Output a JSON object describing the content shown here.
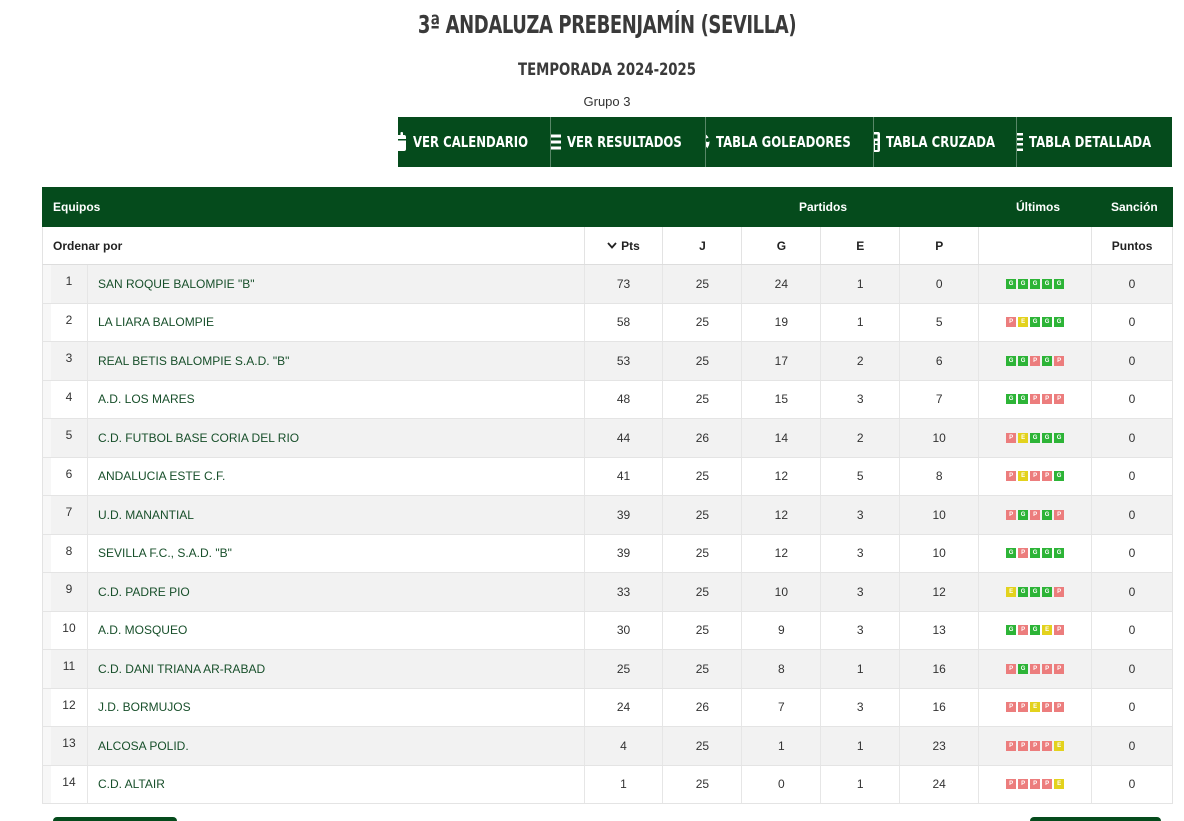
{
  "header": {
    "title": "3ª ANDALUZA PREBENJAMÍN (SEVILLA)",
    "season": "TEMPORADA 2024-2025",
    "group": "Grupo 3"
  },
  "toolbar": [
    {
      "label": "VER CALENDARIO",
      "icon": "calendar-icon"
    },
    {
      "label": "VER RESULTADOS",
      "icon": "list-icon"
    },
    {
      "label": "TABLA GOLEADORES",
      "icon": "soccer-ball-icon"
    },
    {
      "label": "TABLA CRUZADA",
      "icon": "calculator-icon"
    },
    {
      "label": "TABLA DETALLADA",
      "icon": "indent-icon"
    }
  ],
  "table": {
    "header_top": {
      "teams": "Equipos",
      "matches": "Partidos",
      "last": "Últimos",
      "sanction": "Sanción"
    },
    "header_sub": {
      "order_by": "Ordenar por",
      "pts": "Pts",
      "j": "J",
      "g": "G",
      "e": "E",
      "p": "P",
      "points": "Puntos"
    },
    "rows": [
      {
        "pos": "1",
        "team": "SAN ROQUE BALOMPIE \"B\"",
        "pts": "73",
        "j": "25",
        "g": "24",
        "e": "1",
        "p": "0",
        "last": [
          "G",
          "G",
          "G",
          "G",
          "G"
        ],
        "sanction": "0"
      },
      {
        "pos": "2",
        "team": "LA LIARA BALOMPIE",
        "pts": "58",
        "j": "25",
        "g": "19",
        "e": "1",
        "p": "5",
        "last": [
          "P",
          "E",
          "G",
          "G",
          "G"
        ],
        "sanction": "0"
      },
      {
        "pos": "3",
        "team": "REAL BETIS BALOMPIE S.A.D. \"B\"",
        "pts": "53",
        "j": "25",
        "g": "17",
        "e": "2",
        "p": "6",
        "last": [
          "G",
          "G",
          "P",
          "G",
          "P"
        ],
        "sanction": "0"
      },
      {
        "pos": "4",
        "team": "A.D. LOS MARES",
        "pts": "48",
        "j": "25",
        "g": "15",
        "e": "3",
        "p": "7",
        "last": [
          "G",
          "G",
          "P",
          "P",
          "P"
        ],
        "sanction": "0"
      },
      {
        "pos": "5",
        "team": "C.D. FUTBOL BASE CORIA DEL RIO",
        "pts": "44",
        "j": "26",
        "g": "14",
        "e": "2",
        "p": "10",
        "last": [
          "P",
          "E",
          "G",
          "G",
          "G"
        ],
        "sanction": "0"
      },
      {
        "pos": "6",
        "team": "ANDALUCIA ESTE C.F.",
        "pts": "41",
        "j": "25",
        "g": "12",
        "e": "5",
        "p": "8",
        "last": [
          "P",
          "E",
          "P",
          "P",
          "G"
        ],
        "sanction": "0"
      },
      {
        "pos": "7",
        "team": "U.D. MANANTIAL",
        "pts": "39",
        "j": "25",
        "g": "12",
        "e": "3",
        "p": "10",
        "last": [
          "P",
          "G",
          "P",
          "G",
          "P"
        ],
        "sanction": "0"
      },
      {
        "pos": "8",
        "team": "SEVILLA F.C., S.A.D. \"B\"",
        "pts": "39",
        "j": "25",
        "g": "12",
        "e": "3",
        "p": "10",
        "last": [
          "G",
          "P",
          "G",
          "G",
          "G"
        ],
        "sanction": "0"
      },
      {
        "pos": "9",
        "team": "C.D. PADRE PIO",
        "pts": "33",
        "j": "25",
        "g": "10",
        "e": "3",
        "p": "12",
        "last": [
          "E",
          "G",
          "G",
          "G",
          "P"
        ],
        "sanction": "0"
      },
      {
        "pos": "10",
        "team": "A.D. MOSQUEO",
        "pts": "30",
        "j": "25",
        "g": "9",
        "e": "3",
        "p": "13",
        "last": [
          "G",
          "P",
          "G",
          "E",
          "P"
        ],
        "sanction": "0"
      },
      {
        "pos": "11",
        "team": "C.D. DANI TRIANA AR-RABAD",
        "pts": "25",
        "j": "25",
        "g": "8",
        "e": "1",
        "p": "16",
        "last": [
          "P",
          "G",
          "P",
          "P",
          "P"
        ],
        "sanction": "0"
      },
      {
        "pos": "12",
        "team": "J.D. BORMUJOS",
        "pts": "24",
        "j": "26",
        "g": "7",
        "e": "3",
        "p": "16",
        "last": [
          "P",
          "P",
          "E",
          "P",
          "P"
        ],
        "sanction": "0"
      },
      {
        "pos": "13",
        "team": "ALCOSA POLID.",
        "pts": "4",
        "j": "25",
        "g": "1",
        "e": "1",
        "p": "23",
        "last": [
          "P",
          "P",
          "P",
          "P",
          "E"
        ],
        "sanction": "0"
      },
      {
        "pos": "14",
        "team": "C.D. ALTAIR",
        "pts": "1",
        "j": "25",
        "g": "0",
        "e": "1",
        "p": "24",
        "last": [
          "P",
          "P",
          "P",
          "P",
          "E"
        ],
        "sanction": "0"
      }
    ]
  },
  "colors": {
    "brand": "#054b1c",
    "win": "#2db437",
    "loss": "#ec7d7d",
    "draw": "#e3d21d"
  }
}
